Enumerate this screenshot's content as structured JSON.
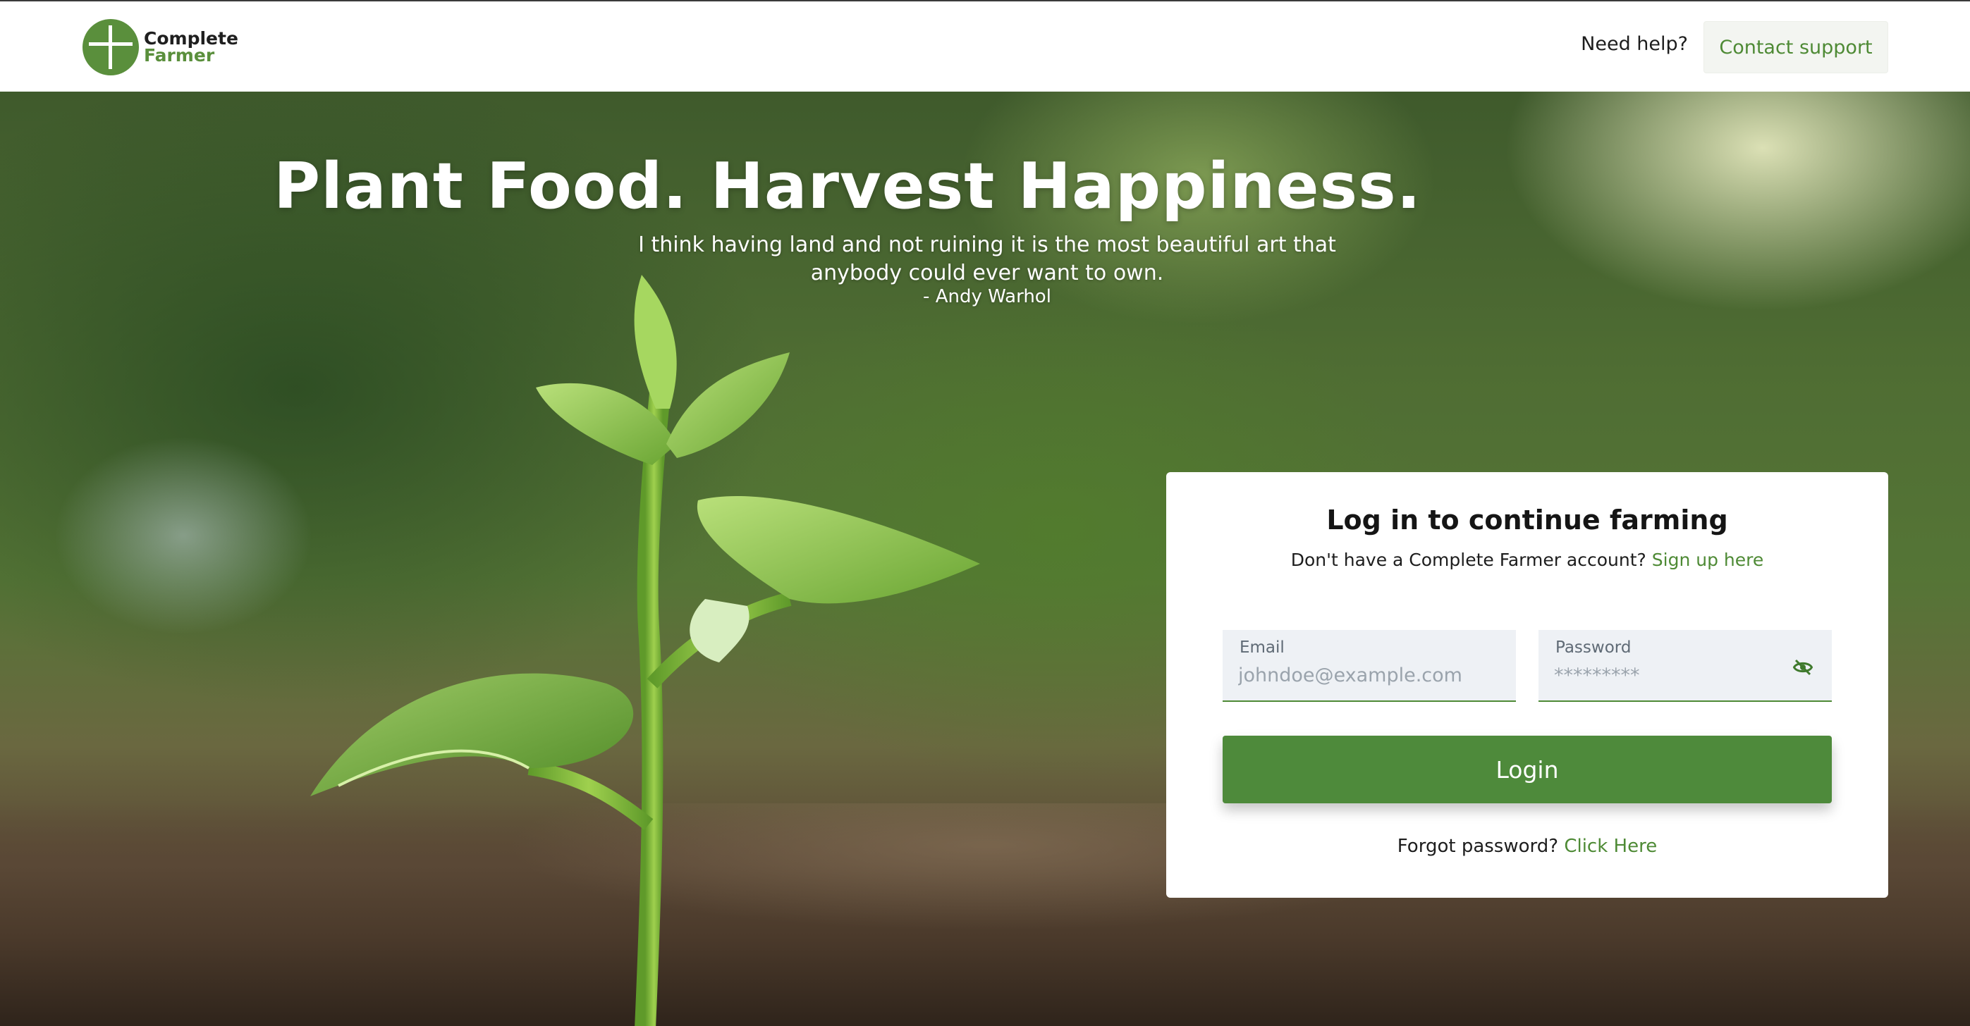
{
  "header": {
    "brand_line1": "Complete",
    "brand_line2": "Farmer",
    "need_help": "Need help?",
    "contact_support": "Contact support"
  },
  "hero": {
    "headline": "Plant Food. Harvest Happiness.",
    "quote": "I think having land and not ruining it is the most beautiful art that anybody could ever want to own.",
    "author": "- Andy Warhol"
  },
  "login_card": {
    "title": "Log in to continue farming",
    "signup_prompt": "Don't have a Complete Farmer account?",
    "signup_link": "Sign up here",
    "email_label": "Email",
    "email_placeholder": "johndoe@example.com",
    "password_label": "Password",
    "password_placeholder": "*********",
    "login_button": "Login",
    "forgot_prompt": "Forgot password?",
    "forgot_link": "Click Here"
  },
  "icons": {
    "logo": "complete-farmer-logo-icon",
    "toggle_password": "eye-off-icon"
  },
  "colors": {
    "brand_green": "#4e8a35",
    "button_green": "#4e8a3b",
    "field_bg": "#eef1f5",
    "support_btn_bg": "#f3f5f1"
  }
}
